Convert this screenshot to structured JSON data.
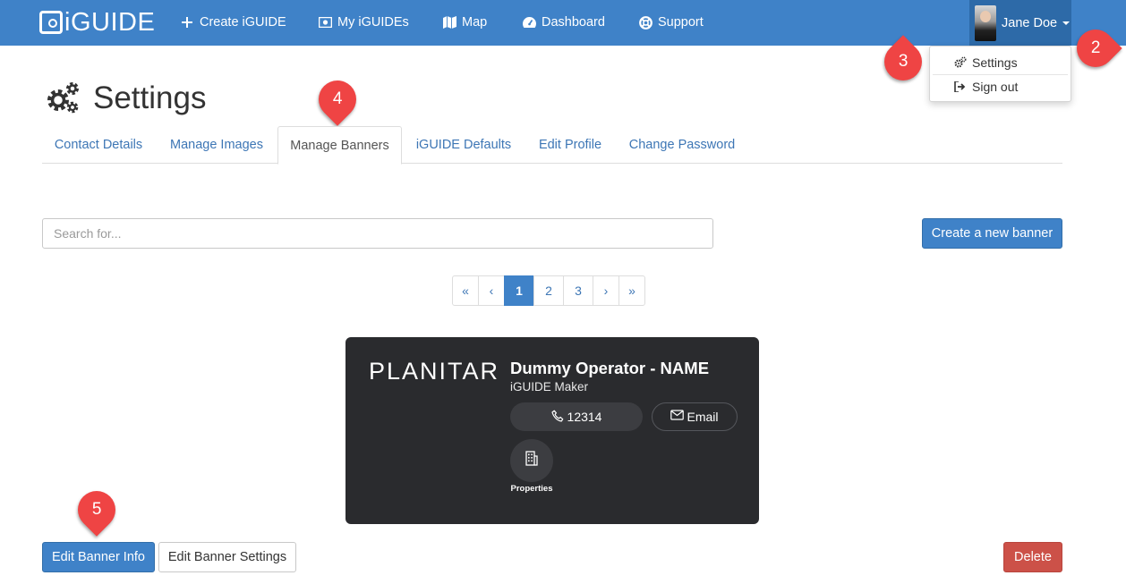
{
  "navbar": {
    "logo_text": "iGUIDE",
    "items": [
      {
        "label": "Create iGUIDE",
        "icon": "plus-icon"
      },
      {
        "label": "My iGUIDEs",
        "icon": "image-icon"
      },
      {
        "label": "Map",
        "icon": "map-icon"
      },
      {
        "label": "Dashboard",
        "icon": "dashboard-icon"
      },
      {
        "label": "Support",
        "icon": "life-ring-icon"
      }
    ],
    "user_name": "Jane Doe"
  },
  "user_menu": {
    "items": [
      {
        "label": "Settings",
        "icon": "gears-icon"
      },
      {
        "label": "Sign out",
        "icon": "sign-out-icon"
      }
    ]
  },
  "markers": [
    "2",
    "3",
    "4",
    "5"
  ],
  "page": {
    "title": "Settings",
    "title_icon": "gears-icon"
  },
  "tabs": [
    {
      "label": "Contact Details",
      "active": false
    },
    {
      "label": "Manage Images",
      "active": false
    },
    {
      "label": "Manage Banners",
      "active": true
    },
    {
      "label": "iGUIDE Defaults",
      "active": false
    },
    {
      "label": "Edit Profile",
      "active": false
    },
    {
      "label": "Change Password",
      "active": false
    }
  ],
  "search": {
    "placeholder": "Search for..."
  },
  "create_button": "Create a new banner",
  "pagination": {
    "first": "«",
    "prev": "‹",
    "pages": [
      "1",
      "2",
      "3"
    ],
    "current": "1",
    "next": "›",
    "last": "»"
  },
  "banner": {
    "brand": "PLANITAR",
    "operator_name": "Dummy Operator - NAME",
    "operator_role": "iGUIDE Maker",
    "phone": "12314",
    "email_label": "Email",
    "properties_label": "Properties",
    "colors": {
      "background": "#2a2b2e",
      "pill": "#3c3d41"
    }
  },
  "actions": {
    "edit_info": "Edit Banner Info",
    "edit_settings": "Edit Banner Settings",
    "delete": "Delete"
  },
  "colors": {
    "navbar": "#3f82c8",
    "primary": "#3f82c8",
    "danger": "#cc5148",
    "marker": "#ef4444",
    "link": "#3d76b5"
  }
}
